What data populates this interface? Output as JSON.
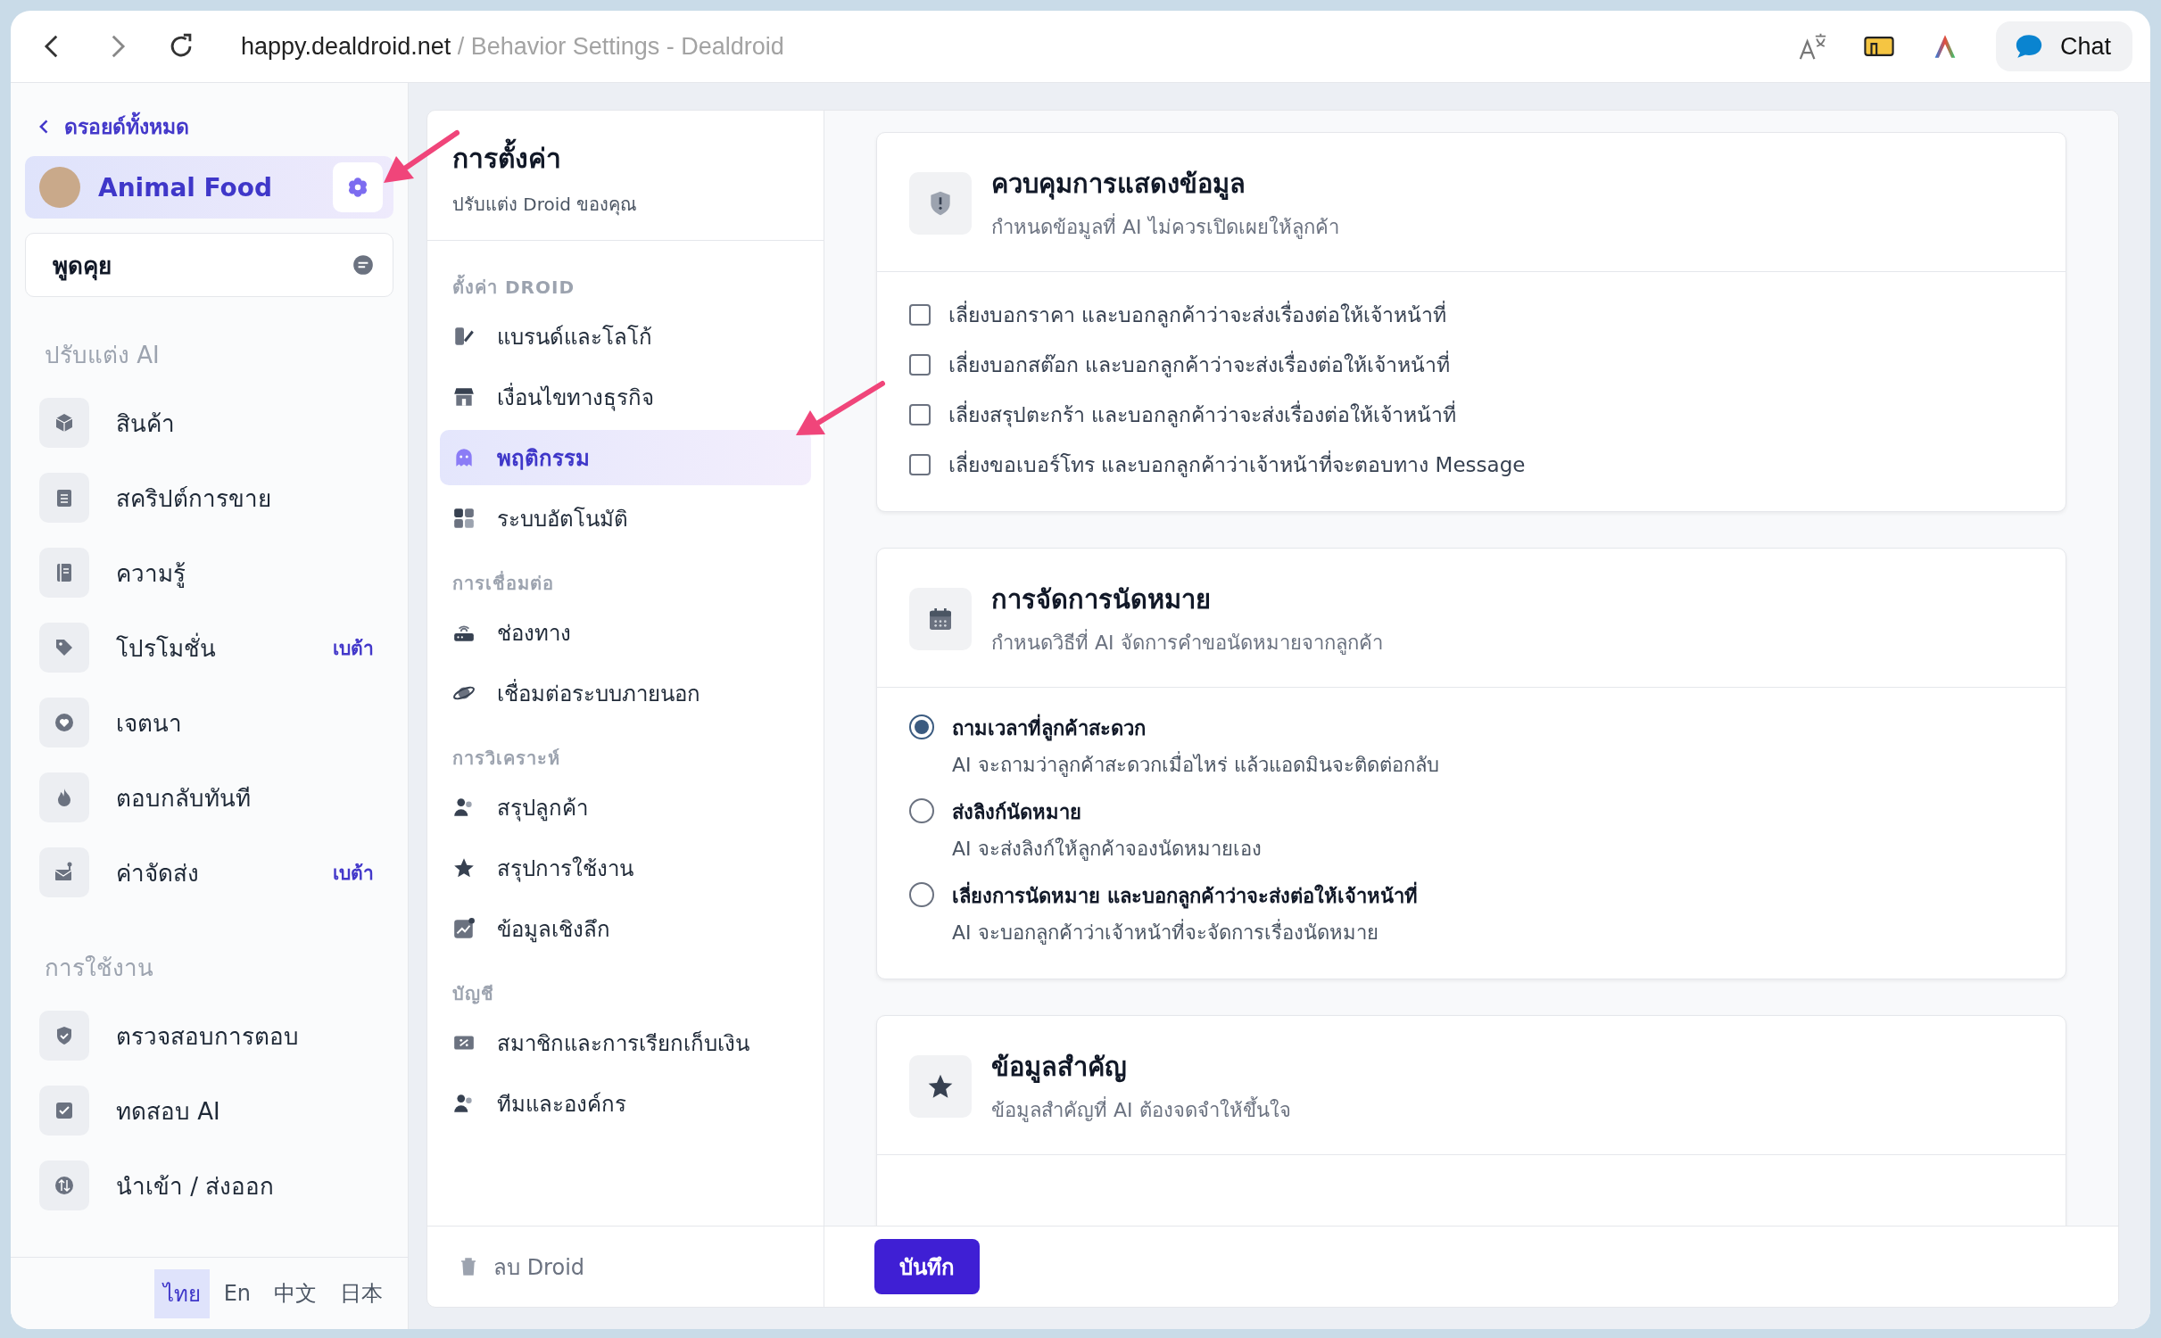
{
  "browser": {
    "url_host": "happy.dealdroid.net",
    "url_path": "/ Behavior Settings - Dealdroid",
    "chat_button": "Chat"
  },
  "sidebar": {
    "back_link": "ดรอยด์ทั้งหมด",
    "droid_name": "Animal Food",
    "chat_item": "พูดคุย",
    "sections": [
      {
        "title": "ปรับแต่ง AI",
        "items": [
          {
            "label": "สินค้า"
          },
          {
            "label": "สคริปต์การขาย"
          },
          {
            "label": "ความรู้"
          },
          {
            "label": "โปรโมชั่น",
            "badge": "เบต้า"
          },
          {
            "label": "เจตนา"
          },
          {
            "label": "ตอบกลับทันที"
          },
          {
            "label": "ค่าจัดส่ง",
            "badge": "เบต้า"
          }
        ]
      },
      {
        "title": "การใช้งาน",
        "items": [
          {
            "label": "ตรวจสอบการตอบ"
          },
          {
            "label": "ทดสอบ AI"
          },
          {
            "label": "นำเข้า / ส่งออก"
          }
        ]
      }
    ],
    "languages": [
      {
        "label": "ไทย",
        "selected": true
      },
      {
        "label": "En",
        "selected": false
      },
      {
        "label": "中文",
        "selected": false
      },
      {
        "label": "日本",
        "selected": false
      }
    ]
  },
  "settings_nav": {
    "title": "การตั้งค่า",
    "subtitle": "ปรับแต่ง Droid ของคุณ",
    "groups": [
      {
        "title": "ตั้งค่า DROID",
        "items": [
          {
            "label": "แบรนด์และโลโก้",
            "selected": false
          },
          {
            "label": "เงื่อนไขทางธุรกิจ",
            "selected": false
          },
          {
            "label": "พฤติกรรม",
            "selected": true
          },
          {
            "label": "ระบบอัตโนมัติ",
            "selected": false
          }
        ]
      },
      {
        "title": "การเชื่อมต่อ",
        "items": [
          {
            "label": "ช่องทาง",
            "selected": false
          },
          {
            "label": "เชื่อมต่อระบบภายนอก",
            "selected": false
          }
        ]
      },
      {
        "title": "การวิเคราะห์",
        "items": [
          {
            "label": "สรุปลูกค้า",
            "selected": false
          },
          {
            "label": "สรุปการใช้งาน",
            "selected": false
          },
          {
            "label": "ข้อมูลเชิงลึก",
            "selected": false
          }
        ]
      },
      {
        "title": "บัญชี",
        "items": [
          {
            "label": "สมาชิกและการเรียกเก็บเงิน",
            "selected": false
          },
          {
            "label": "ทีมและองค์กร",
            "selected": false
          }
        ]
      }
    ],
    "delete": "ลบ Droid"
  },
  "cards": [
    {
      "kind": "checkboxes",
      "title": "ควบคุมการแสดงข้อมูล",
      "subtitle": "กำหนดข้อมูลที่ AI ไม่ควรเปิดเผยให้ลูกค้า",
      "options": [
        {
          "label": "เลี่ยงบอกราคา และบอกลูกค้าว่าจะส่งเรื่องต่อให้เจ้าหน้าที่",
          "checked": false
        },
        {
          "label": "เลี่ยงบอกสต๊อก และบอกลูกค้าว่าจะส่งเรื่องต่อให้เจ้าหน้าที่",
          "checked": false
        },
        {
          "label": "เลี่ยงสรุปตะกร้า และบอกลูกค้าว่าจะส่งเรื่องต่อให้เจ้าหน้าที่",
          "checked": false
        },
        {
          "label": "เลี่ยงขอเบอร์โทร และบอกลูกค้าว่าเจ้าหน้าที่จะตอบทาง Message",
          "checked": false
        }
      ]
    },
    {
      "kind": "radios",
      "title": "การจัดการนัดหมาย",
      "subtitle": "กำหนดวิธีที่ AI จัดการคำขอนัดหมายจากลูกค้า",
      "options": [
        {
          "label": "ถามเวลาที่ลูกค้าสะดวก",
          "description": "AI จะถามว่าลูกค้าสะดวกเมื่อไหร่ แล้วแอดมินจะติดต่อกลับ",
          "selected": true
        },
        {
          "label": "ส่งลิงก์นัดหมาย",
          "description": "AI จะส่งลิงก์ให้ลูกค้าจองนัดหมายเอง",
          "selected": false
        },
        {
          "label": "เลี่ยงการนัดหมาย และบอกลูกค้าว่าจะส่งต่อให้เจ้าหน้าที่",
          "description": "AI จะบอกลูกค้าว่าเจ้าหน้าที่จะจัดการเรื่องนัดหมาย",
          "selected": false
        }
      ]
    },
    {
      "kind": "plain",
      "title": "ข้อมูลสำคัญ",
      "subtitle": "ข้อมูลสำคัญที่ AI ต้องจดจำให้ขึ้นใจ"
    }
  ],
  "save_button": "บันทึก"
}
